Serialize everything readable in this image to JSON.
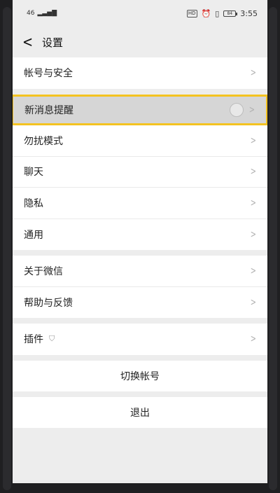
{
  "statusbar": {
    "signal": "46",
    "hd": "HD",
    "battery": "84",
    "time": "3:55"
  },
  "navbar": {
    "back_glyph": "<",
    "title": "设置"
  },
  "groups": [
    {
      "items": [
        {
          "label": "帐号与安全"
        }
      ]
    },
    {
      "items": [
        {
          "label": "新消息提醒"
        },
        {
          "label": "勿扰模式"
        },
        {
          "label": "聊天"
        },
        {
          "label": "隐私"
        },
        {
          "label": "通用"
        }
      ]
    },
    {
      "items": [
        {
          "label": "关于微信"
        },
        {
          "label": "帮助与反馈"
        }
      ]
    },
    {
      "items": [
        {
          "label": "插件"
        }
      ]
    }
  ],
  "actions": {
    "switch_account": "切换帐号",
    "logout": "退出"
  },
  "colors": {
    "highlight_border": "#f4c321",
    "background": "#ededed"
  }
}
